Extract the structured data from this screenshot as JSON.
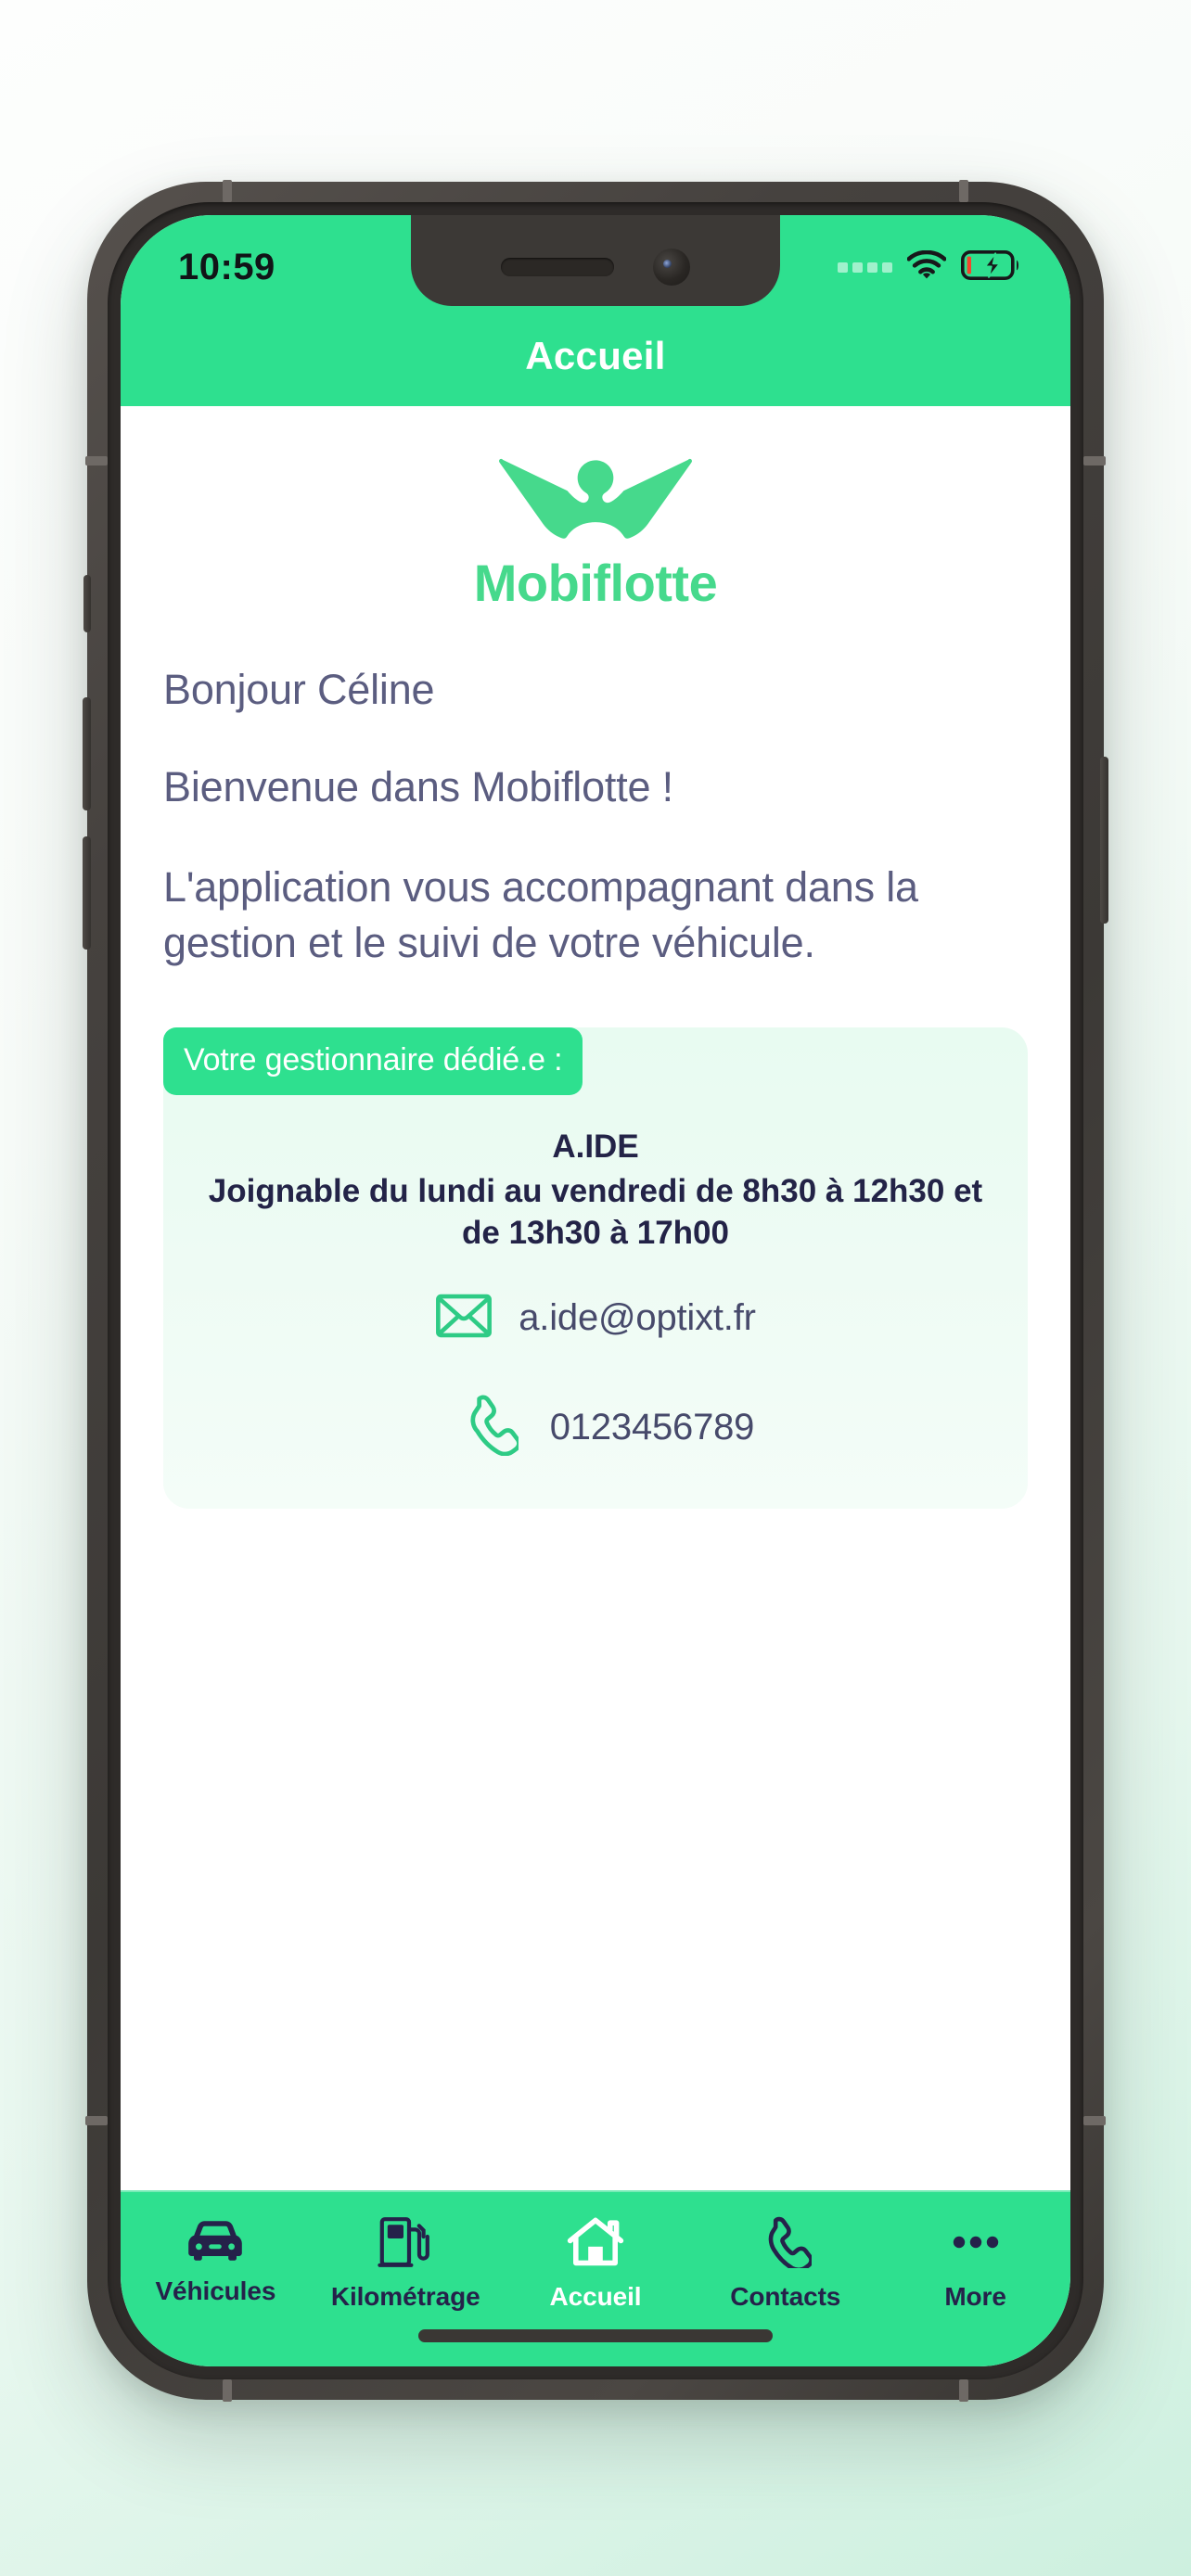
{
  "status_bar": {
    "time": "10:59",
    "signal_icon": "signal-dots-icon",
    "wifi_icon": "wifi-icon",
    "battery_icon": "battery-charging-icon",
    "battery_charging": true
  },
  "app_bar": {
    "title": "Accueil"
  },
  "brand": {
    "logo_icon": "mobiflotte-bird-logo-icon",
    "wordmark": "Mobiflotte",
    "color": "#46d98c"
  },
  "greeting": {
    "hello": "Bonjour Céline",
    "welcome": "Bienvenue dans Mobiflotte !",
    "description": "L'application vous accompagnant dans la gestion et le suivi de votre véhicule."
  },
  "manager_card": {
    "pill_label": "Votre gestionnaire dédié.e :",
    "name": "A.IDE",
    "hours": "Joignable du lundi au vendredi de 8h30 à 12h30 et de 13h30 à 17h00",
    "email": {
      "icon": "envelope-icon",
      "value": "a.ide@optixt.fr"
    },
    "phone": {
      "icon": "phone-icon",
      "value": "0123456789"
    }
  },
  "tab_bar": {
    "active_index": 2,
    "tabs": [
      {
        "label": "Véhicules",
        "icon": "car-icon"
      },
      {
        "label": "Kilométrage",
        "icon": "fuel-pump-icon"
      },
      {
        "label": "Accueil",
        "icon": "home-icon"
      },
      {
        "label": "Contacts",
        "icon": "phone-icon"
      },
      {
        "label": "More",
        "icon": "ellipsis-icon"
      }
    ]
  },
  "theme": {
    "accent_green": "#2ee08f",
    "logo_green": "#46d98c",
    "text_slate": "#5b5d80",
    "dark_navy": "#25224a",
    "card_mint": "#eefbf4"
  }
}
